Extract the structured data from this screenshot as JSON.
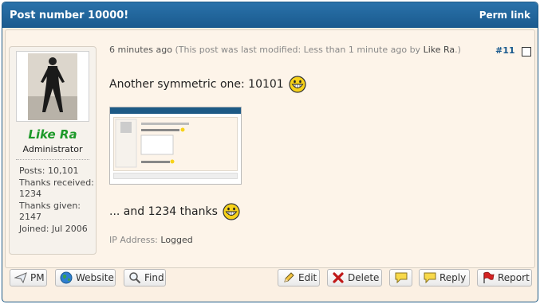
{
  "header": {
    "title": "Post number 10000!",
    "permlink_label": "Perm link"
  },
  "poster": {
    "name": "Like Ra",
    "role": "Administrator",
    "stats": [
      "Posts: 10,101",
      "Thanks received: 1234",
      "Thanks given: 2147",
      "Joined: Jul 2006"
    ]
  },
  "post": {
    "time": "6 minutes ago",
    "modified_prefix": "(This post was last modified: Less than 1 minute ago by",
    "modified_by": "Like Ra",
    "modified_suffix": ".)",
    "number": "#11",
    "line1": "Another symmetric one: 10101",
    "line2": "... and 1234 thanks",
    "ip_label": "IP Address:",
    "ip_value": "Logged"
  },
  "buttons": {
    "pm": "PM",
    "website": "Website",
    "find": "Find",
    "edit": "Edit",
    "delete": "Delete",
    "reply": "Reply",
    "report": "Report"
  },
  "colors": {
    "header": "#1a5a8e",
    "username": "#1e9a2a",
    "post_bg": "#fbf0e3"
  }
}
